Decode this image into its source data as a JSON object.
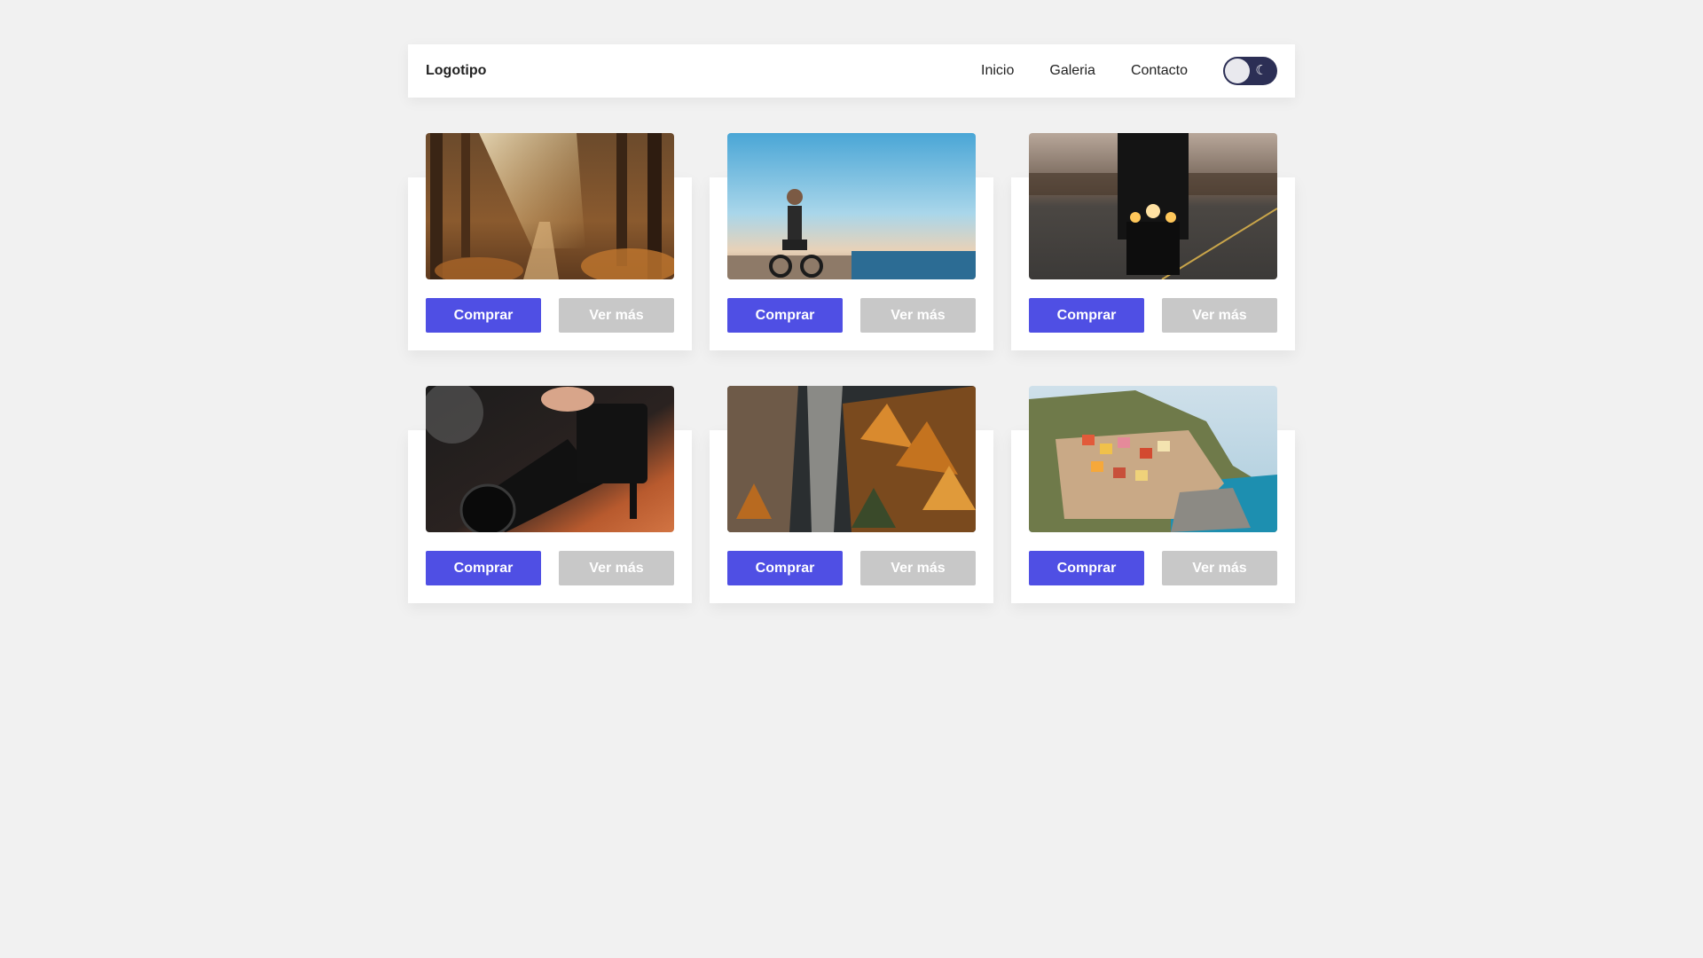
{
  "header": {
    "logo": "Logotipo",
    "nav": [
      "Inicio",
      "Galeria",
      "Contacto"
    ],
    "theme_toggle_icon": "moon-icon"
  },
  "colors": {
    "background": "#f1f1f1",
    "buy_button": "#4f4fe4",
    "more_button": "#c8c8c8",
    "toggle_track": "#2c2f55"
  },
  "cards": [
    {
      "image": "forest-path-photo",
      "buy_label": "Comprar",
      "more_label": "Ver más"
    },
    {
      "image": "cyclist-beach-photo",
      "buy_label": "Comprar",
      "more_label": "Ver más"
    },
    {
      "image": "motorcycle-road-photo",
      "buy_label": "Comprar",
      "more_label": "Ver más"
    },
    {
      "image": "camera-lens-photo",
      "buy_label": "Comprar",
      "more_label": "Ver más"
    },
    {
      "image": "autumn-cliff-photo",
      "buy_label": "Comprar",
      "more_label": "Ver más"
    },
    {
      "image": "coastal-village-photo",
      "buy_label": "Comprar",
      "more_label": "Ver más"
    }
  ]
}
